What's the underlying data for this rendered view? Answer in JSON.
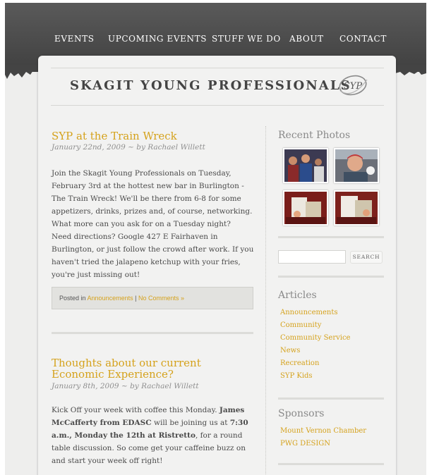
{
  "nav": {
    "items": [
      {
        "label": "EVENTS"
      },
      {
        "label": "UPCOMING EVENTS"
      },
      {
        "label": "STUFF WE DO"
      },
      {
        "label": "ABOUT"
      },
      {
        "label": "CONTACT"
      }
    ]
  },
  "banner": {
    "title": "SKAGIT YOUNG PROFESSIONALS",
    "logo_text": "SYP"
  },
  "posts": [
    {
      "title": "SYP at the Train Wreck",
      "meta": "January 22nd, 2009 ~ by Rachael Willett",
      "paragraphs": [
        "Join the Skagit Young Professionals on Tuesday, February 3rd at the hottest new bar in Burlington - The Train Wreck!  We'll be there from 6-8 for some appetizers, drinks, prizes and, of course, networking.  What more can you ask for on a Tuesday night?",
        "Need directions?  Google 427 E Fairhaven in Burlington, or just follow the crowd after work.  If you haven't tried the jalapeno ketchup with your fries, you're just missing out!"
      ],
      "footer": {
        "posted_in": "Posted in",
        "category": "Announcements",
        "separator": "|",
        "comments": "No Comments »"
      }
    },
    {
      "title": "Thoughts about our current Economic Experience?",
      "meta": "January 8th, 2009 ~ by Rachael Willett",
      "body": {
        "t1": "Kick Off your week with coffee this Monday. ",
        "b1": "James McCafferty from EDASC",
        "t2": " will be joining us at ",
        "b2": "7:30 a.m., Monday the 12th at Ristretto",
        "t3": ", for a round table discussion. So come get your caffeine buzz on and start your week off right!"
      }
    }
  ],
  "sidebar": {
    "recent_photos_heading": "Recent Photos",
    "search": {
      "value": "",
      "button_label": "SEARCH"
    },
    "articles_heading": "Articles",
    "articles": [
      {
        "label": "Announcements"
      },
      {
        "label": "Community"
      },
      {
        "label": "Community Service"
      },
      {
        "label": "News"
      },
      {
        "label": "Recreation"
      },
      {
        "label": "SYP Kids"
      }
    ],
    "sponsors_heading": "Sponsors",
    "sponsors": [
      {
        "label": "Mount Vernon Chamber"
      },
      {
        "label": "PWG DESIGN"
      }
    ]
  },
  "colors": {
    "accent": "#d5a21c",
    "header_bg": "#4a4a4a",
    "page_bg": "#eeeeed"
  },
  "icons": {
    "logo": "syp-swoosh-logo"
  }
}
